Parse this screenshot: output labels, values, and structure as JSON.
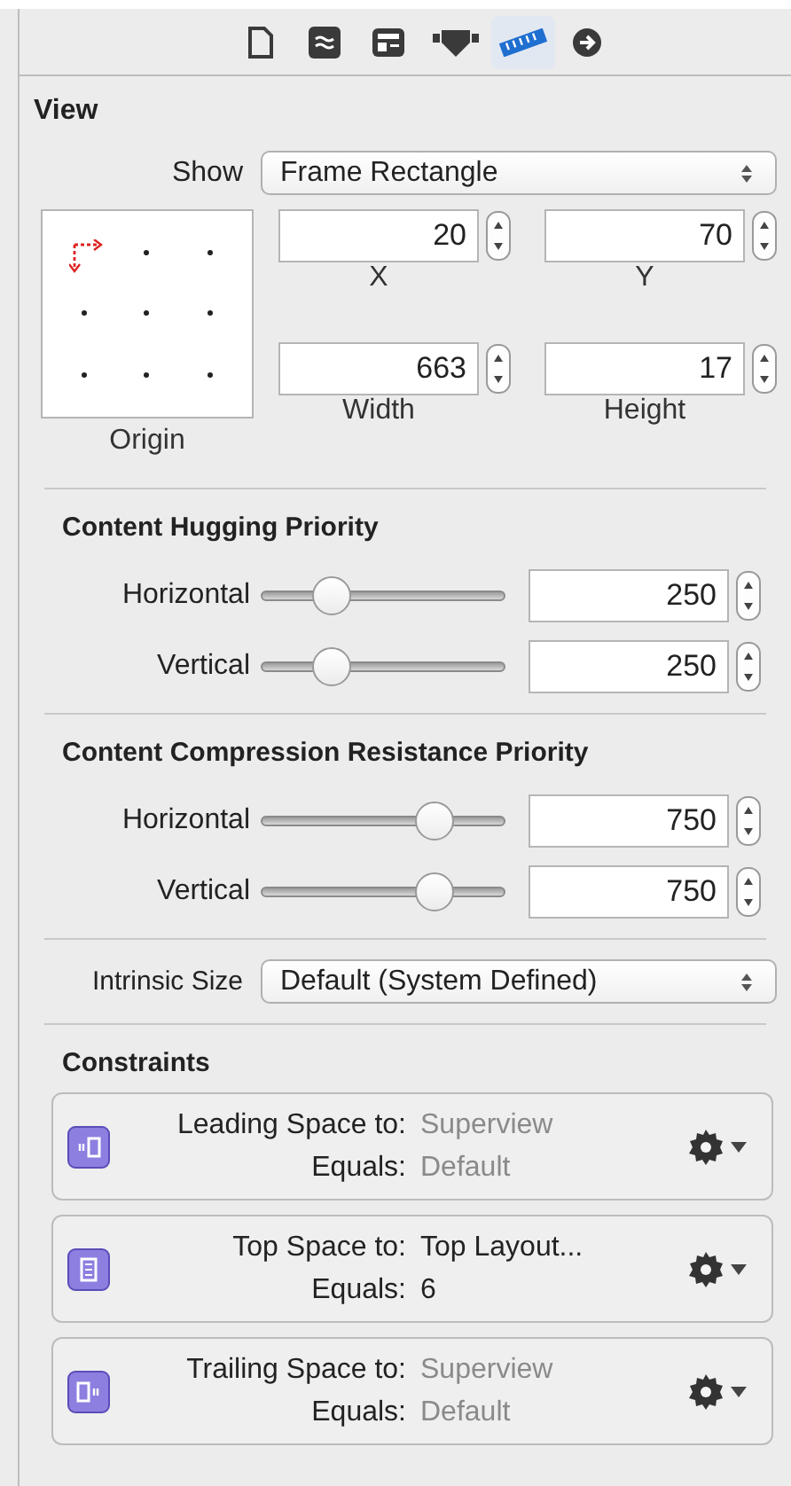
{
  "inspector_tabs": [
    {
      "selected": false
    },
    {
      "selected": false
    },
    {
      "selected": false
    },
    {
      "selected": false
    },
    {
      "selected": true
    },
    {
      "selected": false
    }
  ],
  "view": {
    "heading": "View",
    "show_label": "Show",
    "show_value": "Frame Rectangle",
    "origin_label": "Origin",
    "anchors": [
      {
        "selected": true
      },
      {
        "selected": false
      },
      {
        "selected": false
      },
      {
        "selected": false
      },
      {
        "selected": false
      },
      {
        "selected": false
      },
      {
        "selected": false
      },
      {
        "selected": false
      },
      {
        "selected": false
      }
    ],
    "fields": [
      {
        "label": "X",
        "value": "20"
      },
      {
        "label": "Y",
        "value": "70"
      },
      {
        "label": "Width",
        "value": "663"
      },
      {
        "label": "Height",
        "value": "17"
      }
    ]
  },
  "priorities": [
    {
      "heading": "Content Hugging Priority",
      "rows": [
        {
          "label": "Horizontal",
          "level": 0.25,
          "value": "250"
        },
        {
          "label": "Vertical",
          "level": 0.25,
          "value": "250"
        }
      ]
    },
    {
      "heading": "Content Compression Resistance Priority",
      "rows": [
        {
          "label": "Horizontal",
          "level": 0.75,
          "value": "750"
        },
        {
          "label": "Vertical",
          "level": 0.75,
          "value": "750"
        }
      ]
    }
  ],
  "intrinsic_size": {
    "label": "Intrinsic Size",
    "value": "Default (System Defined)"
  },
  "constraints": {
    "heading": "Constraints",
    "items": [
      {
        "kind": "leading",
        "title": "Leading Space to:",
        "target": "Superview",
        "target_dimmed": true,
        "equals_label": "Equals:",
        "equals": "Default",
        "equals_dimmed": true
      },
      {
        "kind": "top",
        "title": "Top Space to:",
        "target": "Top Layout...",
        "target_dimmed": false,
        "equals_label": "Equals:",
        "equals": "6",
        "equals_dimmed": false
      },
      {
        "kind": "trailing",
        "title": "Trailing Space to:",
        "target": "Superview",
        "target_dimmed": true,
        "equals_label": "Equals:",
        "equals": "Default",
        "equals_dimmed": true
      }
    ]
  }
}
